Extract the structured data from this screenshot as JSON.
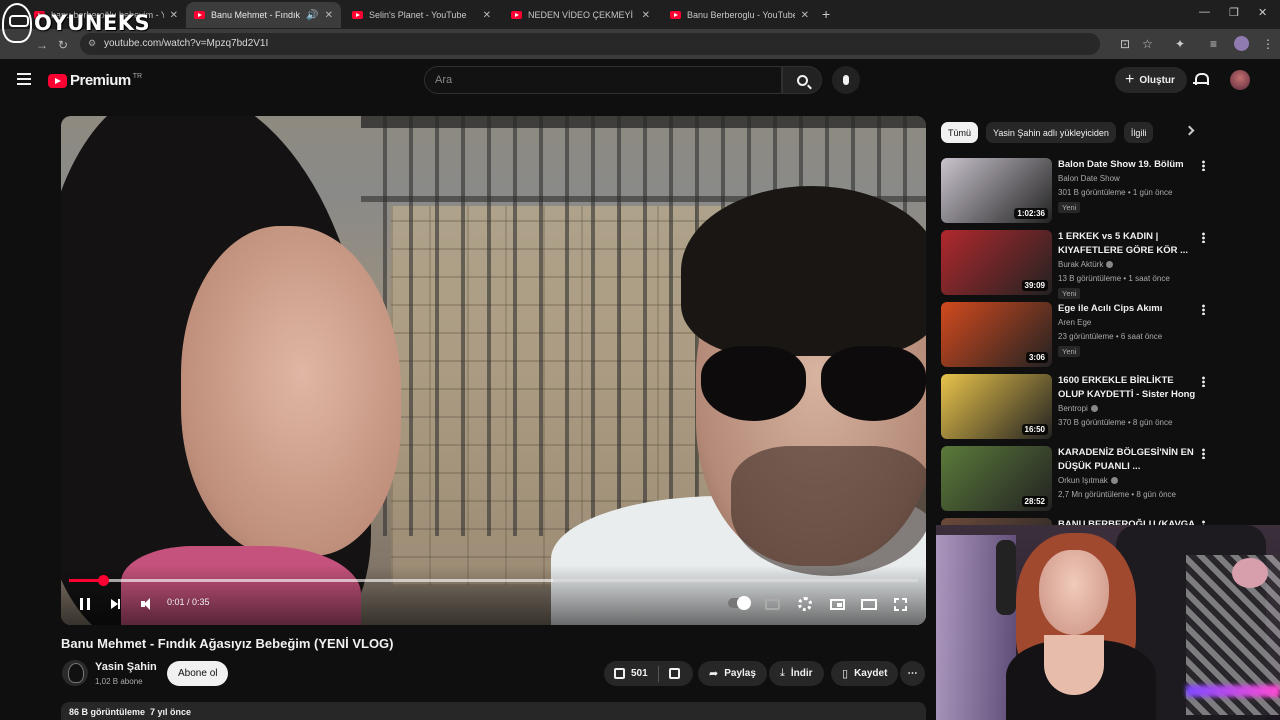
{
  "overlay_brand": "OYUNEKS",
  "browser": {
    "tabs": [
      {
        "title": "banu berberoğlu bebeyim - You",
        "active": false
      },
      {
        "title": "Banu Mehmet - Fındık Ağa",
        "active": true
      },
      {
        "title": "Selin's Planet - YouTube",
        "active": false
      },
      {
        "title": "NEDEN VİDEO ÇEKMEYİ BIRAKT",
        "active": false
      },
      {
        "title": "Banu Berberoglu - YouTube",
        "active": false
      }
    ],
    "url": "youtube.com/watch?v=Mpzq7bd2V1I"
  },
  "header": {
    "logo_text": "Premium",
    "region": "TR",
    "search_placeholder": "Ara",
    "create_label": "Oluştur"
  },
  "player": {
    "current_time": "0:01",
    "duration": "0:35",
    "timecode": "0:01 / 0:35",
    "played_fraction": 0.04,
    "buffered_fraction": 0.57
  },
  "video": {
    "title": "Banu Mehmet - Fındık Ağasıyız Bebeğim (YENİ VLOG)",
    "channel": "Yasin Şahin",
    "subscribers": "1,02 B abone",
    "subscribe_label": "Abone ol",
    "likes": "501",
    "share_label": "Paylaş",
    "download_label": "İndir",
    "save_label": "Kaydet",
    "views_date": "86 B görüntüleme  7 yıl önce"
  },
  "sidebar": {
    "chips": [
      "Tümü",
      "Yasin Şahin adlı yükleyiciden",
      "İlgili"
    ],
    "recommendations": [
      {
        "title": "Balon Date Show 19. Bölüm",
        "channel": "Balon Date Show",
        "verified": false,
        "meta": "301 B görüntüleme • 1 gün önce",
        "badge": "Yeni",
        "duration": "1:02:36",
        "thumb_color": "#c9c3cd"
      },
      {
        "title": "1 ERKEK vs 5 KADIN | KIYAFETLERE GÖRE KÖR ...",
        "channel": "Burak Aktürk",
        "verified": true,
        "meta": "13 B görüntüleme • 1 saat önce",
        "badge": "Yeni",
        "duration": "39:09",
        "thumb_color": "#b0282d"
      },
      {
        "title": "Ege ile Acılı Cips Akımı",
        "channel": "Aren Ege",
        "verified": false,
        "meta": "23 görüntüleme • 6 saat önce",
        "badge": "Yeni",
        "duration": "3:06",
        "thumb_color": "#d24a1e"
      },
      {
        "title": "1600 ERKEKLE BİRLİKTE OLUP KAYDETTİ - Sister Hong",
        "channel": "Bentropi",
        "verified": true,
        "meta": "370 B görüntüleme • 8 gün önce",
        "badge": "",
        "duration": "16:50",
        "thumb_color": "#e8c34a"
      },
      {
        "title": "KARADENİZ BÖLGESİ'NİN EN DÜŞÜK PUANLI ...",
        "channel": "Orkun Işıtmak",
        "verified": true,
        "meta": "2,7 Mn görüntüleme • 8 gün önce",
        "badge": "",
        "duration": "28:52",
        "thumb_color": "#5b7a3a"
      },
      {
        "title": "BANU BERBEROĞLU (KAVGA ...",
        "channel": "",
        "verified": false,
        "meta": "",
        "badge": "",
        "duration": "",
        "thumb_color": "#6b4a3a"
      }
    ]
  }
}
